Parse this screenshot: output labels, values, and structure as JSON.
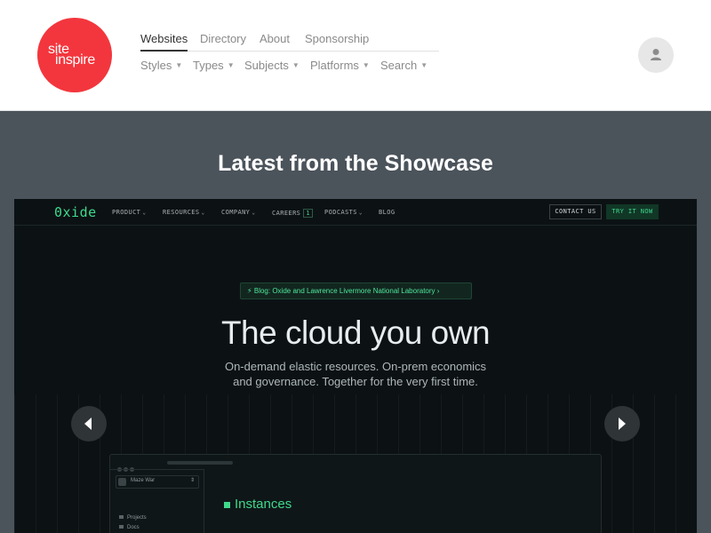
{
  "logo": {
    "line1": "site",
    "line2": "inspire"
  },
  "nav": {
    "top": [
      {
        "label": "Websites",
        "active": true
      },
      {
        "label": "Directory"
      },
      {
        "label": "About"
      },
      {
        "label": "Sponsorship"
      }
    ],
    "bottom": [
      {
        "label": "Styles"
      },
      {
        "label": "Types"
      },
      {
        "label": "Subjects"
      },
      {
        "label": "Platforms"
      },
      {
        "label": "Search"
      }
    ]
  },
  "user": {
    "icon": "user-icon"
  },
  "showcase": {
    "title": "Latest from the Showcase"
  },
  "featured_site": {
    "logo": "0xide",
    "nav": [
      {
        "label": "PRODUCT"
      },
      {
        "label": "RESOURCES"
      },
      {
        "label": "COMPANY"
      },
      {
        "label": "CAREERS",
        "badge": "1"
      },
      {
        "label": "PODCASTS"
      },
      {
        "label": "BLOG"
      }
    ],
    "contact_label": "CONTACT US",
    "try_label": "TRY IT NOW",
    "announcement": "Blog: Oxide and Lawrence Livermore National Laboratory",
    "headline": "The cloud you own",
    "subhead_line1": "On-demand elastic resources. On-prem economics",
    "subhead_line2": "and governance. Together for the very first time.",
    "app_preview": {
      "user_name": "Maze War",
      "sidebar": [
        "Projects",
        "Docs"
      ],
      "title": "Instances"
    }
  },
  "colors": {
    "brand_red": "#f3363d",
    "showcase_bg": "#4b535b",
    "oxide_green": "#3fd98c"
  }
}
